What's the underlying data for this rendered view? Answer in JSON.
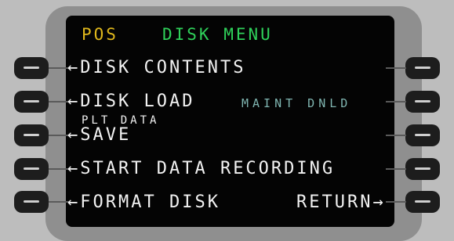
{
  "header": {
    "page_label": "POS",
    "menu_title": "DISK MENU"
  },
  "options": {
    "disk_contents": "DISK CONTENTS",
    "disk_load": "DISK LOAD",
    "maint_dnld": "MAINT DNLD",
    "save_caption": "PLT DATA",
    "save": "SAVE",
    "start_recording": "START DATA RECORDING",
    "format_disk": "FORMAT DISK",
    "return": "RETURN"
  },
  "glyphs": {
    "left_arrow": "←",
    "right_arrow": "→"
  },
  "colors": {
    "title_amber": "#e0b81c",
    "title_green": "#2fd15a",
    "data_cyan": "#7fb5b0",
    "text_white": "#f2f2f2"
  }
}
